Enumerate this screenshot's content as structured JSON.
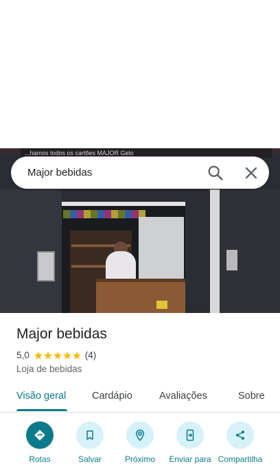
{
  "search": {
    "query": "Major bebidas"
  },
  "photo": {
    "banner_text": "...hamos todos os cartões   MAJOR   Gelo"
  },
  "place": {
    "name": "Major bebidas",
    "rating": "5,0",
    "rating_value": 5,
    "review_count": "(4)",
    "category": "Loja de bebidas"
  },
  "tabs": [
    {
      "label": "Visão geral",
      "active": true
    },
    {
      "label": "Cardápio",
      "active": false
    },
    {
      "label": "Avaliações",
      "active": false
    },
    {
      "label": "Sobre",
      "active": false
    }
  ],
  "actions": [
    {
      "label": "Rotas",
      "icon": "directions-icon"
    },
    {
      "label": "Salvar",
      "icon": "bookmark-icon"
    },
    {
      "label": "Próximo",
      "icon": "nearby-icon"
    },
    {
      "label": "Enviar para",
      "icon": "send-to-phone-icon"
    },
    {
      "label": "Compartilha",
      "icon": "share-icon"
    }
  ],
  "colors": {
    "accent": "#0b7a8b",
    "action_bg": "#d6f2f8",
    "star": "#fbbc04"
  }
}
